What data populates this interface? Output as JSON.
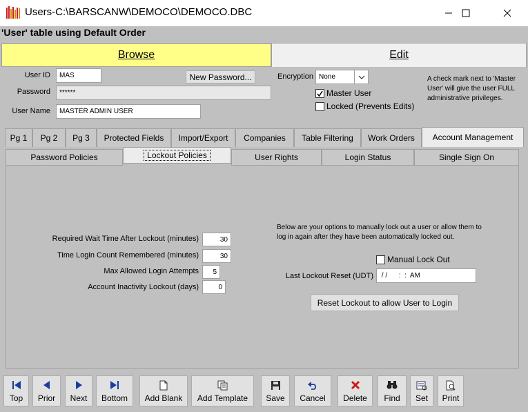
{
  "window": {
    "title": "Users-C:\\BARSCANW\\DEMOCO\\DEMOCO.DBC",
    "minimize_icon": "minimize-icon",
    "maximize_icon": "maximize-icon",
    "close_icon": "close-icon"
  },
  "header": {
    "table_heading": "'User' table using Default Order"
  },
  "mode_tabs": {
    "browse": "Browse",
    "edit": "Edit",
    "browse_color": "#ffff88"
  },
  "user_form": {
    "user_id_label": "User ID",
    "user_id_value": "MAS",
    "new_password_button": "New Password...",
    "password_label": "Password",
    "password_value": "******",
    "user_name_label": "User Name",
    "user_name_value": "MASTER ADMIN USER",
    "encryption_label": "Encryption",
    "encryption_value": "None",
    "master_user_label": "Master User",
    "master_user_checked": true,
    "locked_label": "Locked (Prevents Edits)",
    "locked_checked": false,
    "master_user_note": "A check mark next to 'Master User' will give the user FULL administrative privileges."
  },
  "tabs_primary": [
    "Pg 1",
    "Pg 2",
    "Pg 3",
    "Protected Fields",
    "Import/Export",
    "Companies",
    "Table Filtering",
    "Work Orders",
    "Account Management"
  ],
  "tabs_secondary": [
    "Password Policies",
    "Lockout Policies",
    "User Rights",
    "Login Status",
    "Single Sign On"
  ],
  "lockout": {
    "wait_time_label": "Required Wait Time After Lockout (minutes)",
    "wait_time_value": "30",
    "count_remembered_label": "Time Login Count Remembered (minutes)",
    "count_remembered_value": "30",
    "max_attempts_label": "Max Allowed Login Attempts",
    "max_attempts_value": "5",
    "inactivity_label": "Account Inactivity Lockout (days)",
    "inactivity_value": "0",
    "manual_note": "Below are your options to manually lock out a user or allow them to log in again after they have been automatically locked out.",
    "manual_lockout_label": "Manual Lock Out",
    "manual_lockout_checked": false,
    "last_reset_label": "Last Lockout Reset (UDT)",
    "last_reset_value": " / /      :  :  AM",
    "reset_button": "Reset Lockout to allow User to Login"
  },
  "toolbar": {
    "top": "Top",
    "prior": "Prior",
    "next": "Next",
    "bottom": "Bottom",
    "add_blank": "Add Blank",
    "add_template": "Add Template",
    "save": "Save",
    "cancel": "Cancel",
    "delete": "Delete",
    "find": "Find",
    "set": "Set",
    "print": "Print",
    "nav_icon_color": "#1a3d9e",
    "delete_icon_color": "#cc1a1a"
  }
}
